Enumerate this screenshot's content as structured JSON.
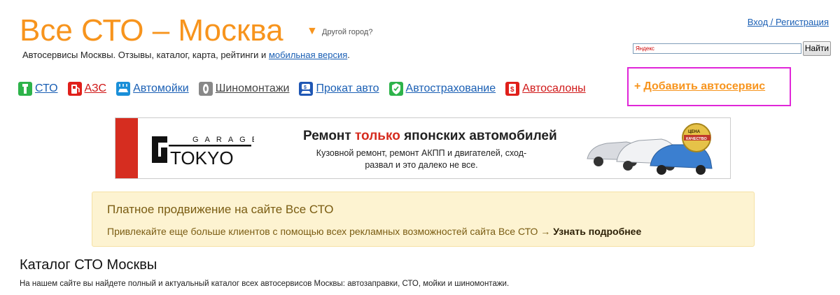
{
  "header": {
    "site_title": "Все СТО – Москва",
    "city_toggle_glyph": "▼",
    "other_city": "Другой город?",
    "subtitle_text": "Автосервисы Москвы. Отзывы, каталог, карта, рейтинги и ",
    "mobile_link": "мобильная версия",
    "subtitle_end": ".",
    "login": "Вход / Регистрация",
    "accent_color": "#f7941d"
  },
  "search": {
    "placeholder": "Яндекс",
    "button": "Найти"
  },
  "nav": {
    "items": [
      {
        "label": "СТО",
        "icon": "wrench-icon",
        "color": "#2db34a"
      },
      {
        "label": "АЗС",
        "icon": "fuel-pump-icon",
        "color": "#e0201b"
      },
      {
        "label": "Автомойки",
        "icon": "car-wash-icon",
        "color": "#1a8fd8"
      },
      {
        "label": "Шиномонтажи",
        "icon": "tire-icon",
        "color": "#888888"
      },
      {
        "label": "Прокат авто",
        "icon": "car-rental-icon",
        "color": "#1f57b4"
      },
      {
        "label": "Автострахование",
        "icon": "shield-icon",
        "color": "#2db34a"
      },
      {
        "label": "Автосалоны",
        "icon": "dollar-tag-icon",
        "color": "#e0201b"
      }
    ],
    "add_service_plus": "+",
    "add_service": "Добавить автосервис"
  },
  "banner": {
    "logo_top": "GARAGE",
    "logo_bottom": "TOKYO",
    "headline_pre": "Ремонт ",
    "headline_accent": "только",
    "headline_post": " японских автомобилей",
    "subtext": "Кузовной ремонт, ремонт АКПП и двигателей, сход-развал и это далеко не все.",
    "badge_top": "ЦЕНА",
    "badge_bottom": "КАЧЕСТВО"
  },
  "promo": {
    "title": "Платное продвижение на сайте Все СТО",
    "text": "Привлекайте еще больше клиентов с помощью всех рекламных возможностей сайта Все СТО → ",
    "link": "Узнать подробнее"
  },
  "catalog": {
    "title": "Каталог СТО Москвы",
    "description": "На нашем сайте вы найдете полный и актуальный каталог всех автосервисов Москвы: автозаправки, СТО, мойки и шиномонтажи."
  }
}
